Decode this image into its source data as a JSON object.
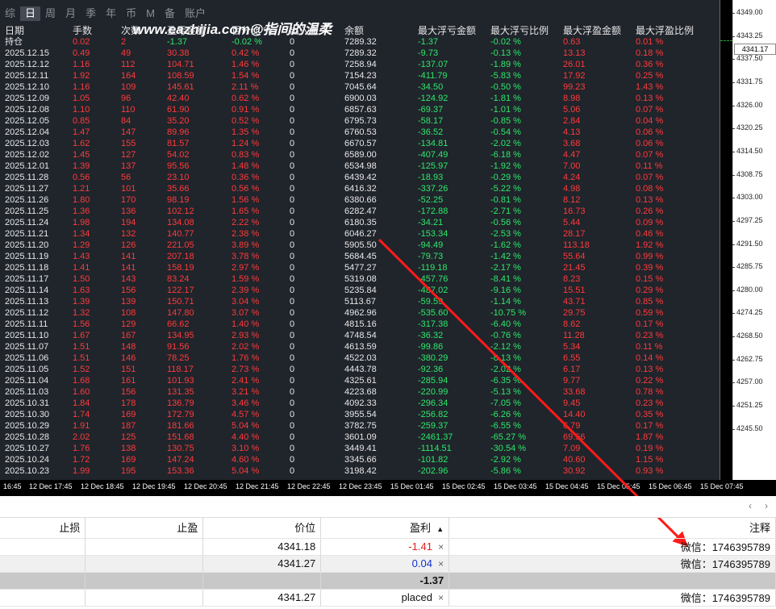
{
  "tabs": [
    "综",
    "日",
    "周",
    "月",
    "季",
    "年",
    "币",
    "M",
    "备",
    "账户"
  ],
  "active_tab": 1,
  "watermark": "www.eazhijia.com@指间的温柔",
  "stats": {
    "headers": [
      "日期",
      "手数",
      "次数",
      "盈亏金额",
      "百分比 %",
      "出入金",
      "余额",
      "最大浮亏金额",
      "最大浮亏比例",
      "最大浮盈金额",
      "最大浮盈比例"
    ],
    "hold_row": [
      "持仓",
      "0.02",
      "2",
      "-1.37",
      "-0.02 %",
      "0",
      "7289.32",
      "-1.37",
      "-0.02 %",
      "0.63",
      "0.01 %"
    ],
    "rows": [
      [
        "2025.12.15",
        "0.49",
        "49",
        "30.38",
        "0.42 %",
        "0",
        "7289.32",
        "-9.73",
        "-0.13 %",
        "13.13",
        "0.18 %"
      ],
      [
        "2025.12.12",
        "1.16",
        "112",
        "104.71",
        "1.46 %",
        "0",
        "7258.94",
        "-137.07",
        "-1.89 %",
        "26.01",
        "0.36 %"
      ],
      [
        "2025.12.11",
        "1.92",
        "164",
        "108.59",
        "1.54 %",
        "0",
        "7154.23",
        "-411.79",
        "-5.83 %",
        "17.92",
        "0.25 %"
      ],
      [
        "2025.12.10",
        "1.16",
        "109",
        "145.61",
        "2.11 %",
        "0",
        "7045.64",
        "-34.50",
        "-0.50 %",
        "99.23",
        "1.43 %"
      ],
      [
        "2025.12.09",
        "1.05",
        "96",
        "42.40",
        "0.62 %",
        "0",
        "6900.03",
        "-124.92",
        "-1.81 %",
        "8.98",
        "0.13 %"
      ],
      [
        "2025.12.08",
        "1.10",
        "110",
        "61.90",
        "0.91 %",
        "0",
        "6857.63",
        "-69.37",
        "-1.01 %",
        "5.06",
        "0.07 %"
      ],
      [
        "2025.12.05",
        "0.85",
        "84",
        "35.20",
        "0.52 %",
        "0",
        "6795.73",
        "-58.17",
        "-0.85 %",
        "2.84",
        "0.04 %"
      ],
      [
        "2025.12.04",
        "1.47",
        "147",
        "89.96",
        "1.35 %",
        "0",
        "6760.53",
        "-36.52",
        "-0.54 %",
        "4.13",
        "0.06 %"
      ],
      [
        "2025.12.03",
        "1.62",
        "155",
        "81.57",
        "1.24 %",
        "0",
        "6670.57",
        "-134.81",
        "-2.02 %",
        "3.68",
        "0.06 %"
      ],
      [
        "2025.12.02",
        "1.45",
        "127",
        "54.02",
        "0.83 %",
        "0",
        "6589.00",
        "-407.49",
        "-6.18 %",
        "4.47",
        "0.07 %"
      ],
      [
        "2025.12.01",
        "1.39",
        "137",
        "95.56",
        "1.48 %",
        "0",
        "6534.98",
        "-125.97",
        "-1.92 %",
        "7.00",
        "0.11 %"
      ],
      [
        "2025.11.28",
        "0.56",
        "56",
        "23.10",
        "0.36 %",
        "0",
        "6439.42",
        "-18.93",
        "-0.29 %",
        "4.24",
        "0.07 %"
      ],
      [
        "2025.11.27",
        "1.21",
        "101",
        "35.66",
        "0.56 %",
        "0",
        "6416.32",
        "-337.26",
        "-5.22 %",
        "4.98",
        "0.08 %"
      ],
      [
        "2025.11.26",
        "1.80",
        "170",
        "98.19",
        "1.56 %",
        "0",
        "6380.66",
        "-52.25",
        "-0.81 %",
        "8.12",
        "0.13 %"
      ],
      [
        "2025.11.25",
        "1.36",
        "136",
        "102.12",
        "1.65 %",
        "0",
        "6282.47",
        "-172.88",
        "-2.71 %",
        "16.73",
        "0.26 %"
      ],
      [
        "2025.11.24",
        "1.98",
        "194",
        "134.08",
        "2.22 %",
        "0",
        "6180.35",
        "-34.21",
        "-0.56 %",
        "5.44",
        "0.09 %"
      ],
      [
        "2025.11.21",
        "1.34",
        "132",
        "140.77",
        "2.38 %",
        "0",
        "6046.27",
        "-153.34",
        "-2.53 %",
        "28.17",
        "0.46 %"
      ],
      [
        "2025.11.20",
        "1.29",
        "126",
        "221.05",
        "3.89 %",
        "0",
        "5905.50",
        "-94.49",
        "-1.62 %",
        "113.18",
        "1.92 %"
      ],
      [
        "2025.11.19",
        "1.43",
        "141",
        "207.18",
        "3.78 %",
        "0",
        "5684.45",
        "-79.73",
        "-1.42 %",
        "55.64",
        "0.99 %"
      ],
      [
        "2025.11.18",
        "1.41",
        "141",
        "158.19",
        "2.97 %",
        "0",
        "5477.27",
        "-119.18",
        "-2.17 %",
        "21.45",
        "0.39 %"
      ],
      [
        "2025.11.17",
        "1.50",
        "143",
        "83.24",
        "1.59 %",
        "0",
        "5319.08",
        "-457.76",
        "-8.41 %",
        "8.23",
        "0.15 %"
      ],
      [
        "2025.11.14",
        "1.63",
        "156",
        "122.17",
        "2.39 %",
        "0",
        "5235.84",
        "-487.02",
        "-9.16 %",
        "15.51",
        "0.29 %"
      ],
      [
        "2025.11.13",
        "1.39",
        "139",
        "150.71",
        "3.04 %",
        "0",
        "5113.67",
        "-59.59",
        "-1.14 %",
        "43.71",
        "0.85 %"
      ],
      [
        "2025.11.12",
        "1.32",
        "108",
        "147.80",
        "3.07 %",
        "0",
        "4962.96",
        "-535.60",
        "-10.75 %",
        "29.75",
        "0.59 %"
      ],
      [
        "2025.11.11",
        "1.56",
        "129",
        "66.62",
        "1.40 %",
        "0",
        "4815.16",
        "-317.38",
        "-6.40 %",
        "8.62",
        "0.17 %"
      ],
      [
        "2025.11.10",
        "1.67",
        "167",
        "134.95",
        "2.93 %",
        "0",
        "4748.54",
        "-36.32",
        "-0.76 %",
        "11.28",
        "0.23 %"
      ],
      [
        "2025.11.07",
        "1.51",
        "148",
        "91.56",
        "2.02 %",
        "0",
        "4613.59",
        "-99.86",
        "-2.12 %",
        "5.34",
        "0.11 %"
      ],
      [
        "2025.11.06",
        "1.51",
        "146",
        "78.25",
        "1.76 %",
        "0",
        "4522.03",
        "-380.29",
        "-8.13 %",
        "6.55",
        "0.14 %"
      ],
      [
        "2025.11.05",
        "1.52",
        "151",
        "118.17",
        "2.73 %",
        "0",
        "4443.78",
        "-92.36",
        "-2.02 %",
        "6.17",
        "0.13 %"
      ],
      [
        "2025.11.04",
        "1.68",
        "161",
        "101.93",
        "2.41 %",
        "0",
        "4325.61",
        "-285.94",
        "-6.35 %",
        "9.77",
        "0.22 %"
      ],
      [
        "2025.11.03",
        "1.60",
        "156",
        "131.35",
        "3.21 %",
        "0",
        "4223.68",
        "-220.99",
        "-5.13 %",
        "33.68",
        "0.78 %"
      ],
      [
        "2025.10.31",
        "1.84",
        "178",
        "136.79",
        "3.46 %",
        "0",
        "4092.33",
        "-296.34",
        "-7.05 %",
        "9.45",
        "0.23 %"
      ],
      [
        "2025.10.30",
        "1.74",
        "169",
        "172.79",
        "4.57 %",
        "0",
        "3955.54",
        "-256.82",
        "-6.26 %",
        "14.40",
        "0.35 %"
      ],
      [
        "2025.10.29",
        "1.91",
        "187",
        "181.66",
        "5.04 %",
        "0",
        "3782.75",
        "-259.37",
        "-6.55 %",
        "6.79",
        "0.17 %"
      ],
      [
        "2025.10.28",
        "2.02",
        "125",
        "151.68",
        "4.40 %",
        "0",
        "3601.09",
        "-2461.37",
        "-65.27 %",
        "69.56",
        "1.87 %"
      ],
      [
        "2025.10.27",
        "1.76",
        "138",
        "130.75",
        "3.10 %",
        "0",
        "3449.41",
        "-1114.51",
        "-30.54 %",
        "7.09",
        "0.19 %"
      ],
      [
        "2025.10.24",
        "1.72",
        "169",
        "147.24",
        "4.60 %",
        "0",
        "3345.66",
        "-101.82",
        "-2.92 %",
        "40.60",
        "1.15 %"
      ],
      [
        "2025.10.23",
        "1.99",
        "195",
        "153.36",
        "5.04 %",
        "0",
        "3198.42",
        "-202.96",
        "-5.86 %",
        "30.92",
        "0.93 %"
      ]
    ]
  },
  "price_scale": [
    "4349.00",
    "4343.25",
    "4337.50",
    "4331.75",
    "4326.00",
    "4320.25",
    "4314.50",
    "4308.75",
    "4303.00",
    "4297.25",
    "4291.50",
    "4285.75",
    "4280.00",
    "4274.25",
    "4268.50",
    "4262.75",
    "4257.00",
    "4251.25",
    "4245.50"
  ],
  "current_price": "4341.17",
  "time_axis": [
    "16:45",
    "12 Dec 17:45",
    "12 Dec 18:45",
    "12 Dec 19:45",
    "12 Dec 20:45",
    "12 Dec 21:45",
    "12 Dec 22:45",
    "12 Dec 23:45",
    "15 Dec 01:45",
    "15 Dec 02:45",
    "15 Dec 03:45",
    "15 Dec 04:45",
    "15 Dec 05:45",
    "15 Dec 06:45",
    "15 Dec 07:45"
  ],
  "nav": {
    "left": "‹",
    "right": "›"
  },
  "orders": {
    "headers": {
      "sl": "止损",
      "tp": "止盈",
      "price": "价位",
      "profit": "盈利",
      "sort_icon": "▲",
      "comment": "注释"
    },
    "rows": [
      {
        "sl": "",
        "tp": "",
        "price": "4341.18",
        "profit": "-1.41",
        "close": "×",
        "comment": "微信：1746395789"
      },
      {
        "sl": "",
        "tp": "",
        "price": "4341.27",
        "profit": "0.04",
        "close": "×",
        "comment": "微信：1746395789"
      }
    ],
    "total": "-1.37",
    "pending": {
      "sl": "",
      "tp": "",
      "price": "4341.27",
      "status": "placed",
      "close": "×",
      "comment": "微信：1746395789"
    }
  },
  "colors": {
    "panel_bg": "#20242b",
    "profit_red": "#ff3b3b",
    "loss_green": "#2ee86b",
    "arrow": "#ff1a1a"
  }
}
